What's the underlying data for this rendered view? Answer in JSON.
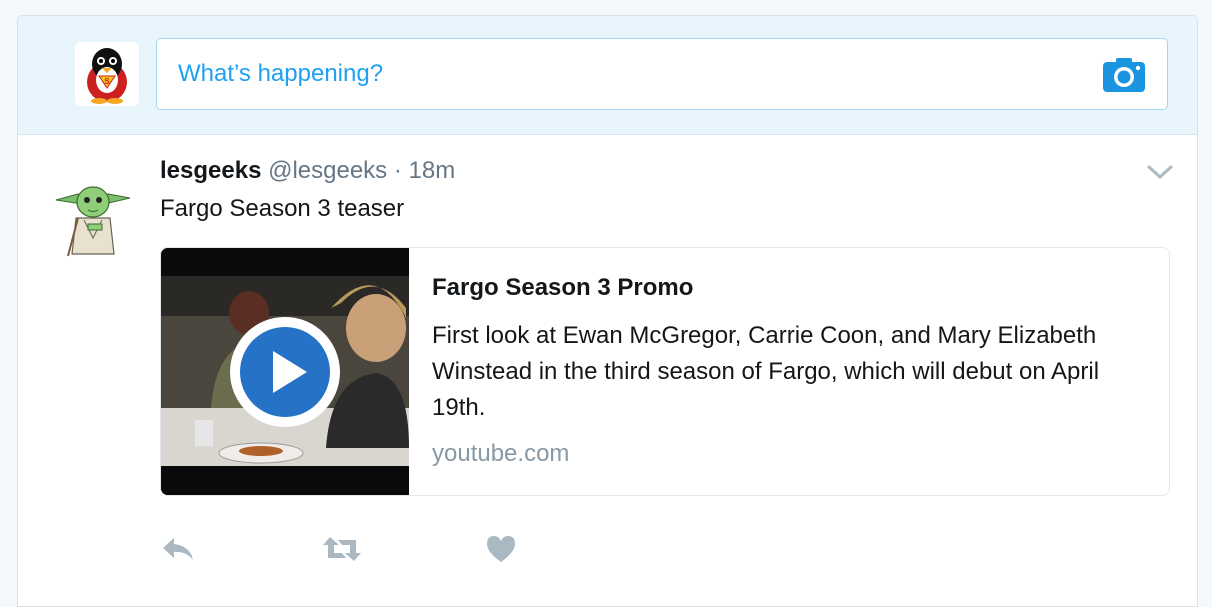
{
  "compose": {
    "placeholder": "What’s happening?",
    "avatar_icon": "penguin-superman-avatar",
    "camera_icon": "camera-icon"
  },
  "tweet": {
    "fullname": "lesgeeks",
    "username": "@lesgeeks",
    "separator": "·",
    "time": "18m",
    "text": "Fargo Season 3 teaser",
    "avatar_icon": "yoda-avatar"
  },
  "card": {
    "title": "Fargo Season 3 Promo",
    "description": "First look at Ewan McGregor, Carrie Coon, and Mary Elizabeth Winstead in the third season of Fargo, which will debut on April 19th.",
    "domain": "youtube.com",
    "media_icon": "play-icon"
  },
  "actions": [
    "reply-icon",
    "retweet-icon",
    "like-icon"
  ],
  "colors": {
    "accent": "#1da1f2",
    "compose_bg": "#e8f5fd",
    "muted": "#657786",
    "action_icon": "#aab8c2"
  }
}
